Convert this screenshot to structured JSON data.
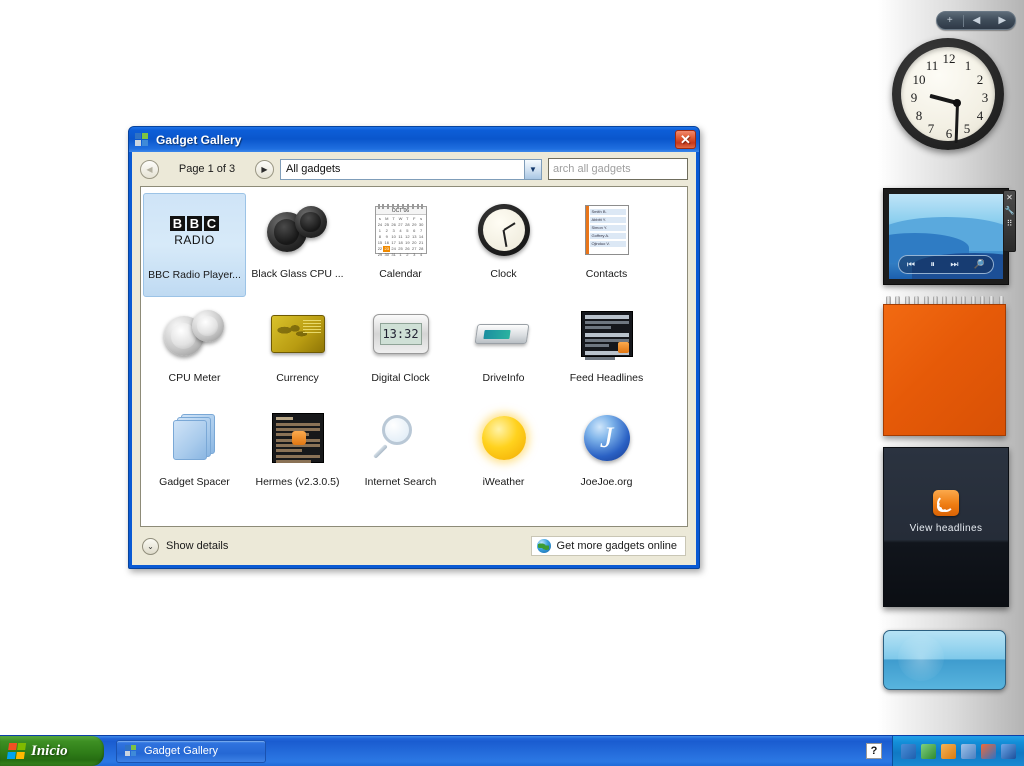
{
  "window": {
    "title": "Gadget Gallery",
    "icon": "gadget-gallery-icon",
    "close_label": "✕",
    "toolbar": {
      "prev_label": "◀",
      "next_label": "▶",
      "page_label": "Page 1 of 3",
      "category_value": "All gadgets",
      "category_options": [
        "All gadgets"
      ],
      "dropdown_arrow": "▼",
      "search_value": "",
      "search_placeholder": "arch all gadgets"
    },
    "gadgets": [
      {
        "label": "BBC Radio Player...",
        "icon": "bbc-radio-icon",
        "selected": true
      },
      {
        "label": "Black Glass CPU ...",
        "icon": "black-glass-cpu-icon",
        "selected": false
      },
      {
        "label": "Calendar",
        "icon": "calendar-icon",
        "selected": false
      },
      {
        "label": "Clock",
        "icon": "clock-icon",
        "selected": false
      },
      {
        "label": "Contacts",
        "icon": "contacts-icon",
        "selected": false
      },
      {
        "label": "CPU Meter",
        "icon": "cpu-meter-icon",
        "selected": false
      },
      {
        "label": "Currency",
        "icon": "currency-icon",
        "selected": false
      },
      {
        "label": "Digital Clock",
        "icon": "digital-clock-icon",
        "selected": false
      },
      {
        "label": "DriveInfo",
        "icon": "driveinfo-icon",
        "selected": false
      },
      {
        "label": "Feed Headlines",
        "icon": "feed-headlines-icon",
        "selected": false
      },
      {
        "label": "Gadget Spacer",
        "icon": "gadget-spacer-icon",
        "selected": false
      },
      {
        "label": "Hermes (v2.3.0.5)",
        "icon": "hermes-icon",
        "selected": false
      },
      {
        "label": "Internet Search",
        "icon": "internet-search-icon",
        "selected": false
      },
      {
        "label": "iWeather",
        "icon": "iweather-icon",
        "selected": false
      },
      {
        "label": "JoeJoe.org",
        "icon": "joejoe-icon",
        "selected": false
      }
    ],
    "thumbnails": {
      "bbc_letters": [
        "B",
        "B",
        "C"
      ],
      "bbc_word": "RADIO",
      "calendar_month": "OCT 06",
      "calendar_days": [
        "s",
        "M",
        "T",
        "W",
        "T",
        "F",
        "s"
      ],
      "calendar_dates": [
        "24",
        "25",
        "26",
        "27",
        "28",
        "29",
        "30",
        "1",
        "2",
        "3",
        "4",
        "5",
        "6",
        "7",
        "8",
        "9",
        "10",
        "11",
        "12",
        "13",
        "14",
        "15",
        "16",
        "17",
        "18",
        "19",
        "20",
        "21",
        "22",
        "23",
        "24",
        "25",
        "26",
        "27",
        "28",
        "29",
        "30",
        "31",
        "1",
        "2",
        "3",
        "4"
      ],
      "calendar_highlight": "23",
      "digital_clock_time": "13:32",
      "contacts_names": [
        "Smith B.",
        "Abbitt Y.",
        "Simon Y.",
        "Goffrey A.",
        "Ojinduo V."
      ],
      "joejoe_letter": "J"
    },
    "footer": {
      "show_details_label": "Show details",
      "chevron": "⌄",
      "get_more_label": "Get more gadgets online",
      "globe_icon": "globe-icon"
    }
  },
  "sidebar": {
    "header": {
      "add_label": "+",
      "prev_label": "◀",
      "next_label": "▶"
    },
    "gadgets": [
      {
        "name": "clock",
        "time": "9:30",
        "numerals": [
          "12",
          "1",
          "2",
          "3",
          "4",
          "5",
          "6",
          "7",
          "8",
          "9",
          "10",
          "11"
        ]
      },
      {
        "name": "slideshow",
        "controls": [
          "⏮",
          "⏸",
          "⏭",
          "🔎"
        ],
        "side_controls": [
          "✕",
          "🔧",
          "⠿"
        ]
      },
      {
        "name": "notes",
        "color": "#e65a08"
      },
      {
        "name": "feed-headlines",
        "label": "View headlines",
        "icon": "rss-icon"
      },
      {
        "name": "weather",
        "color": "#58b4de"
      }
    ]
  },
  "taskbar": {
    "start_label": "Inicio",
    "start_icon": "windows-flag-icon",
    "tasks": [
      {
        "label": "Gadget Gallery",
        "icon": "gadget-gallery-icon",
        "active": true
      }
    ],
    "tray": {
      "help_label": "?",
      "icons": [
        "sidebar-icon",
        "security-icon",
        "java-icon",
        "network-icon",
        "windows-icon",
        "xear3d-icon"
      ],
      "icon_colors": [
        "#3a78c4",
        "#4ba84b",
        "#e08b1e",
        "#6f9fd8",
        "#d84b2a",
        "#2f6fd0"
      ]
    }
  },
  "colors": {
    "titlebar": "#0a56cc",
    "window_face": "#ece9d8",
    "accent_orange": "#e65a08",
    "taskbar_blue": "#1a5cd0",
    "start_green": "#2f7d18",
    "selection_blue": "#cfe4f7"
  }
}
